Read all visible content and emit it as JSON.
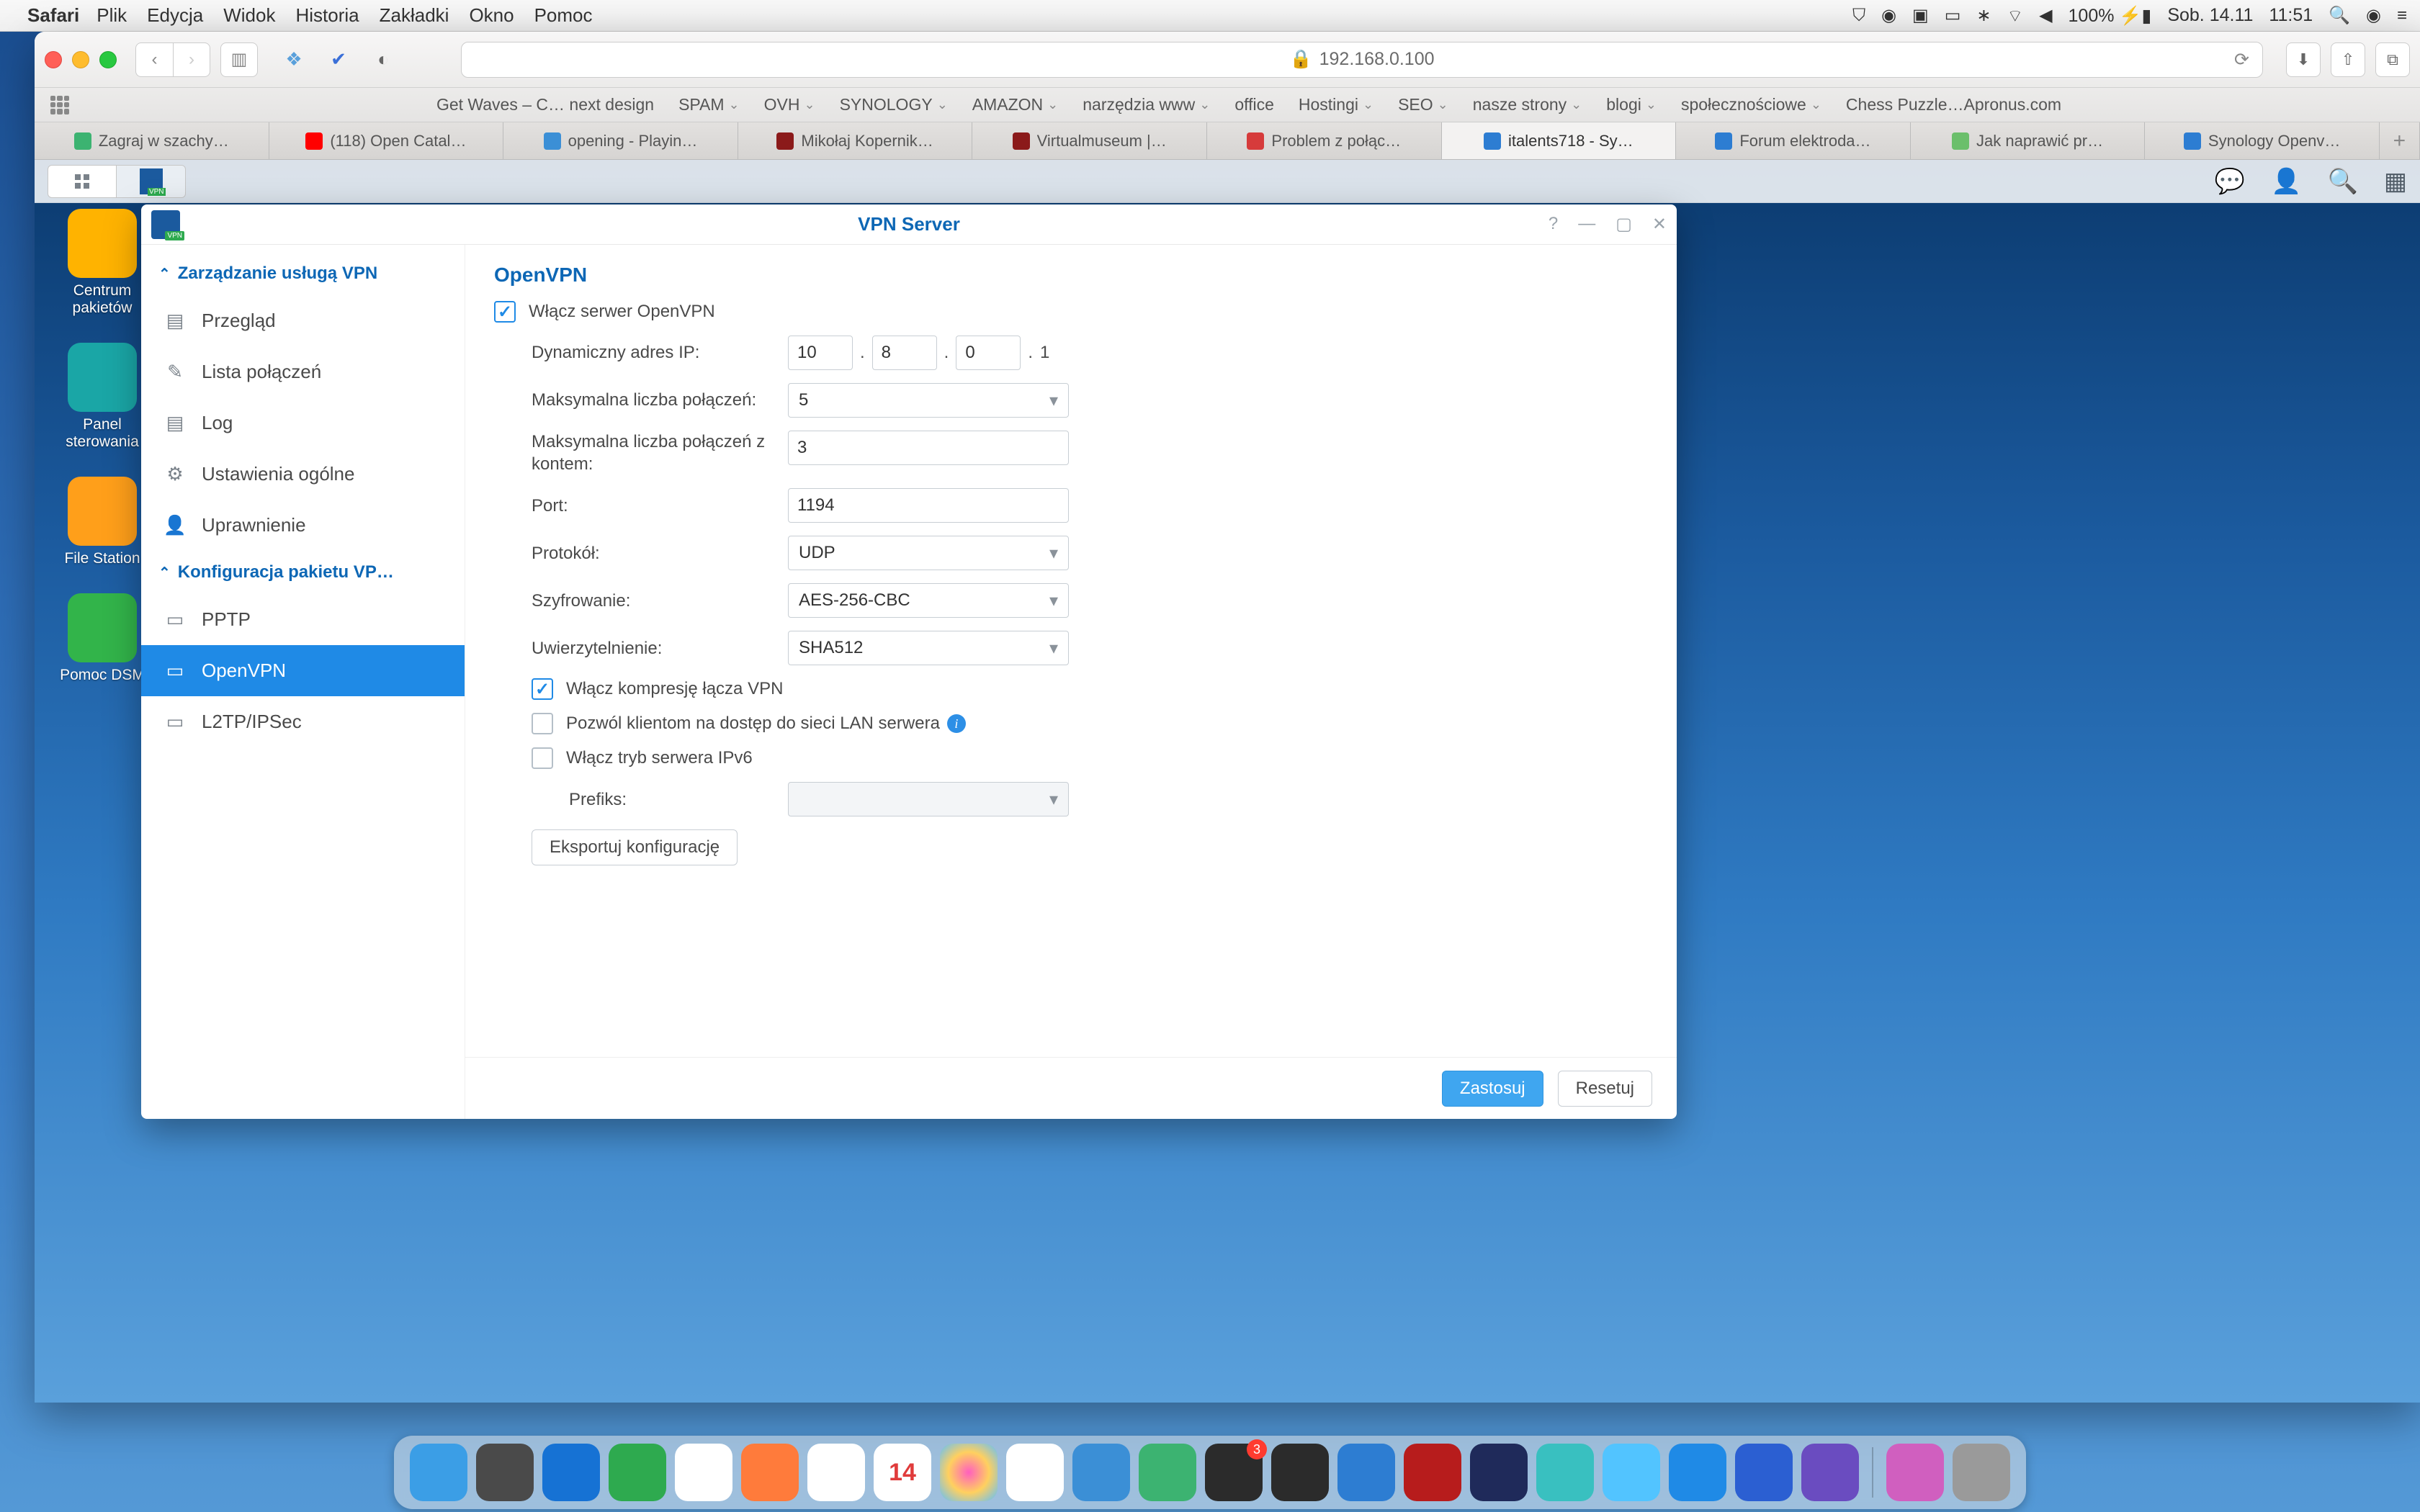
{
  "menubar": {
    "app": "Safari",
    "items": [
      "Plik",
      "Edycja",
      "Widok",
      "Historia",
      "Zakładki",
      "Okno",
      "Pomoc"
    ],
    "battery": "100%",
    "date": "Sob. 14.11",
    "time": "11:51"
  },
  "safari": {
    "url": "192.168.0.100",
    "favorites": [
      "Get Waves – C… next design",
      "SPAM",
      "OVH",
      "SYNOLOGY",
      "AMAZON",
      "narzędzia www",
      "office",
      "Hostingi",
      "SEO",
      "nasze strony",
      "blogi",
      "społecznościowe",
      "Chess Puzzle…Apronus.com"
    ],
    "fav_dropdown": [
      false,
      true,
      true,
      true,
      true,
      true,
      false,
      true,
      true,
      true,
      true,
      true,
      false
    ],
    "tabs": [
      {
        "label": "Zagraj w szachy…",
        "color": "#3cb371"
      },
      {
        "label": "(118) Open Catal…",
        "color": "#ff0000"
      },
      {
        "label": "opening - Playin…",
        "color": "#3b8fd6"
      },
      {
        "label": "Mikołaj Kopernik…",
        "color": "#8b1a1a"
      },
      {
        "label": "Virtualmuseum |…",
        "color": "#8b1a1a"
      },
      {
        "label": "Problem z połąc…",
        "color": "#d63b3b"
      },
      {
        "label": "italents718 - Sy…",
        "color": "#2d7dd2"
      },
      {
        "label": "Forum elektroda…",
        "color": "#2d7dd2"
      },
      {
        "label": "Jak naprawić pr…",
        "color": "#6bbf6b"
      },
      {
        "label": "Synology Openv…",
        "color": "#2d7dd2"
      }
    ],
    "active_tab": 6
  },
  "dsm": {
    "desktop_icons": [
      {
        "label": "Centrum pakietów",
        "bg": "#ffb300"
      },
      {
        "label": "Panel sterowania",
        "bg": "#1aa6a6"
      },
      {
        "label": "File Station",
        "bg": "#ff9f1a"
      },
      {
        "label": "Pomoc DSM",
        "bg": "#32b44a"
      }
    ]
  },
  "win": {
    "title": "VPN Server",
    "sidebar": {
      "group1": "Zarządzanie usługą VPN",
      "items1": [
        "Przegląd",
        "Lista połączeń",
        "Log",
        "Ustawienia ogólne",
        "Uprawnienie"
      ],
      "group2": "Konfiguracja pakietu VP…",
      "items2": [
        "PPTP",
        "OpenVPN",
        "L2TP/IPSec"
      ],
      "active": "OpenVPN"
    },
    "main": {
      "heading": "OpenVPN",
      "enable_label": "Włącz serwer OpenVPN",
      "enable_checked": true,
      "dyn_ip_label": "Dynamiczny adres IP:",
      "dyn_ip": [
        "10",
        "8",
        "0"
      ],
      "dyn_ip_suffix": "1",
      "max_conn_label": "Maksymalna liczba połączeń:",
      "max_conn": "5",
      "max_conn_acct_label": "Maksymalna liczba połączeń z kontem:",
      "max_conn_acct": "3",
      "port_label": "Port:",
      "port": "1194",
      "proto_label": "Protokół:",
      "proto": "UDP",
      "enc_label": "Szyfrowanie:",
      "enc": "AES-256-CBC",
      "auth_label": "Uwierzytelnienie:",
      "auth": "SHA512",
      "compress_label": "Włącz kompresję łącza VPN",
      "compress_checked": true,
      "lan_label": "Pozwól klientom na dostęp do sieci LAN serwera",
      "lan_checked": false,
      "ipv6_label": "Włącz tryb serwera IPv6",
      "ipv6_checked": false,
      "prefix_label": "Prefiks:",
      "prefix": "",
      "export_label": "Eksportuj konfigurację",
      "apply": "Zastosuj",
      "reset": "Resetuj"
    }
  },
  "dock": {
    "apps": [
      {
        "bg": "#3b9ee6"
      },
      {
        "bg": "#4a4a4a"
      },
      {
        "bg": "#1672d4"
      },
      {
        "bg": "#2eaa4f"
      },
      {
        "bg": "#ffffff"
      },
      {
        "bg": "#ff7b3b"
      },
      {
        "bg": "#ffffff"
      },
      {
        "bg": "#ffffff"
      },
      {
        "bg": "radial-gradient(circle,#ff5fbf,#ffd05f,#5fbfff)"
      },
      {
        "bg": "#ffffff"
      },
      {
        "bg": "#3b8fd6"
      },
      {
        "bg": "#3cb371"
      },
      {
        "bg": "#2b2b2b",
        "badge": "3"
      },
      {
        "bg": "#2b2b2b"
      },
      {
        "bg": "#2d7dd2"
      },
      {
        "bg": "#b71c1c"
      },
      {
        "bg": "#1f2a5a"
      },
      {
        "bg": "#39c0c0"
      },
      {
        "bg": "#52c4ff"
      },
      {
        "bg": "#1f8ae6"
      },
      {
        "bg": "#2b5fd2"
      },
      {
        "bg": "#6a4cc0"
      },
      {
        "bg": "#d05fbf"
      },
      {
        "bg": "#9a9a9a"
      }
    ],
    "cal_day": "14",
    "sep_after": 21
  }
}
